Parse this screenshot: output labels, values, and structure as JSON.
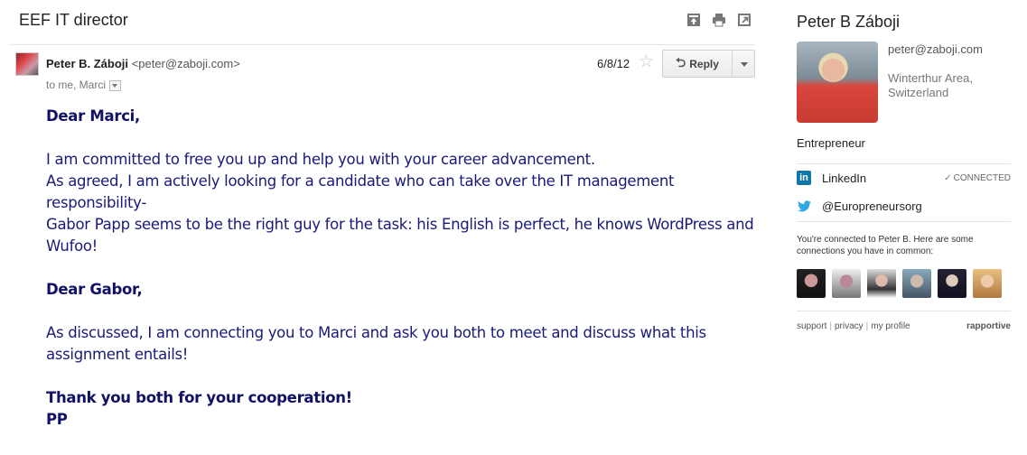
{
  "email": {
    "subject": "EEF IT director",
    "sender_name": "Peter B. Záboji",
    "sender_email": "<peter@zaboji.com>",
    "recipients": "to me, Marci",
    "date": "6/8/12",
    "reply_label": "Reply",
    "body": [
      {
        "text": "Dear Marci,",
        "bold": true
      },
      {
        "text": "",
        "gap": true
      },
      {
        "text": "I am committed to free you up and help you with your career advancement."
      },
      {
        "text": "As agreed, I am actively looking for a candidate who can take over the IT management responsibility-"
      },
      {
        "text": "Gabor Papp seems to be the right guy for the task: his English is perfect, he knows WordPress and Wufoo!"
      },
      {
        "text": "",
        "gap": true
      },
      {
        "text": "Dear Gabor,",
        "bold": true
      },
      {
        "text": "",
        "gap": true
      },
      {
        "text": "As discussed, I am connecting you to Marci and ask you both to meet and discuss what this assignment entails!"
      },
      {
        "text": "",
        "gap": true
      },
      {
        "text": "Thank you both for your cooperation!",
        "bold": true
      },
      {
        "text": "PP",
        "bold": true
      }
    ]
  },
  "top_actions": [
    {
      "name": "archive-icon"
    },
    {
      "name": "print-icon"
    },
    {
      "name": "new-window-icon"
    }
  ],
  "sidebar": {
    "name": "Peter B Záboji",
    "email": "peter@zaboji.com",
    "location": "Winterthur Area, Switzerland",
    "title": "Entrepreneur",
    "linkedin_label": "LinkedIn",
    "linkedin_status": "CONNECTED",
    "twitter_handle": "@Europreneursorg",
    "common_text": "You're connected to Peter B. Here are some connections you have in common:",
    "connections_count": 6,
    "footer_links": [
      "support",
      "privacy",
      "my profile"
    ],
    "brand": "rapportive"
  },
  "colors": {
    "body_text": "#1a1a7a",
    "linkedin": "#0e76a8",
    "twitter": "#2fa9e0"
  }
}
